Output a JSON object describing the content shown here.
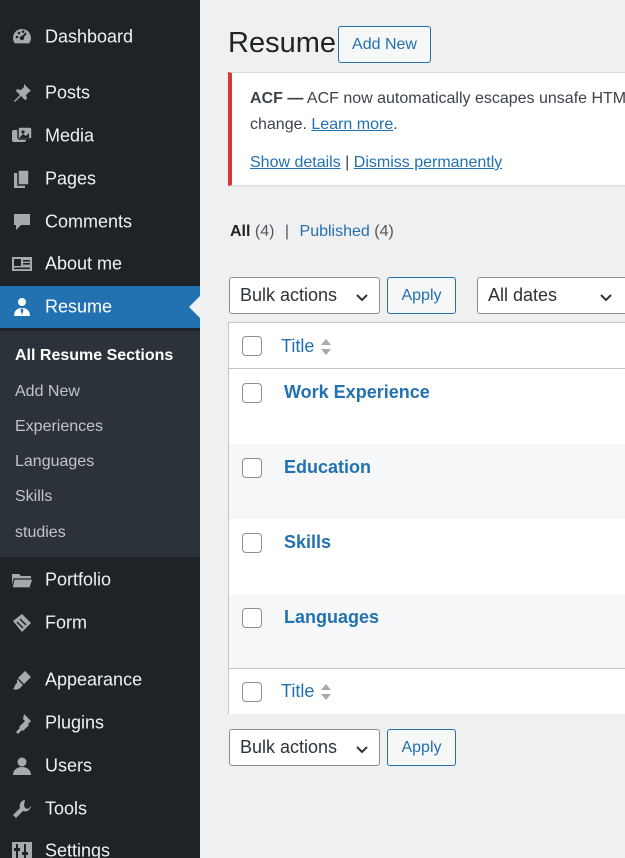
{
  "sidebar": {
    "items": [
      {
        "label": "Dashboard",
        "icon": "dashboard-icon"
      },
      {
        "label": "Posts",
        "icon": "pin-icon"
      },
      {
        "label": "Media",
        "icon": "media-icon"
      },
      {
        "label": "Pages",
        "icon": "pages-icon"
      },
      {
        "label": "Comments",
        "icon": "comment-icon"
      },
      {
        "label": "About me",
        "icon": "id-card-icon"
      },
      {
        "label": "Resume",
        "icon": "user-icon",
        "active": true
      },
      {
        "label": "Portfolio",
        "icon": "folder-icon"
      },
      {
        "label": "Form",
        "icon": "tag-icon"
      },
      {
        "label": "Appearance",
        "icon": "brush-icon"
      },
      {
        "label": "Plugins",
        "icon": "plugin-icon"
      },
      {
        "label": "Users",
        "icon": "users-icon"
      },
      {
        "label": "Tools",
        "icon": "wrench-icon"
      },
      {
        "label": "Settings",
        "icon": "settings-icon"
      }
    ],
    "submenu": [
      {
        "label": "All Resume Sections",
        "current": true
      },
      {
        "label": "Add New"
      },
      {
        "label": "Experiences"
      },
      {
        "label": "Languages"
      },
      {
        "label": "Skills"
      },
      {
        "label": "studies"
      }
    ]
  },
  "header": {
    "title": "Resume",
    "add_new": "Add New"
  },
  "notice": {
    "strong": "ACF —",
    "line1_text": " ACF now automatically escapes unsafe HTML",
    "line2_text": "change. ",
    "learn_more": "Learn more",
    "line2_end": ".",
    "show_details": "Show details",
    "separator": " | ",
    "dismiss": "Dismiss permanently"
  },
  "filters": {
    "all_label": "All",
    "all_count": "(4)",
    "sep": "|",
    "published_label": "Published",
    "published_count": "(4)"
  },
  "bulk_actions": {
    "label": "Bulk actions",
    "apply": "Apply"
  },
  "dates_filter": {
    "label": "All dates"
  },
  "table": {
    "column_title": "Title",
    "rows": [
      {
        "title": "Work Experience"
      },
      {
        "title": "Education"
      },
      {
        "title": "Skills"
      },
      {
        "title": "Languages"
      }
    ]
  },
  "colors": {
    "sidebar_bg": "#1d2327",
    "accent": "#2271b1",
    "notice_error": "#d63638"
  }
}
